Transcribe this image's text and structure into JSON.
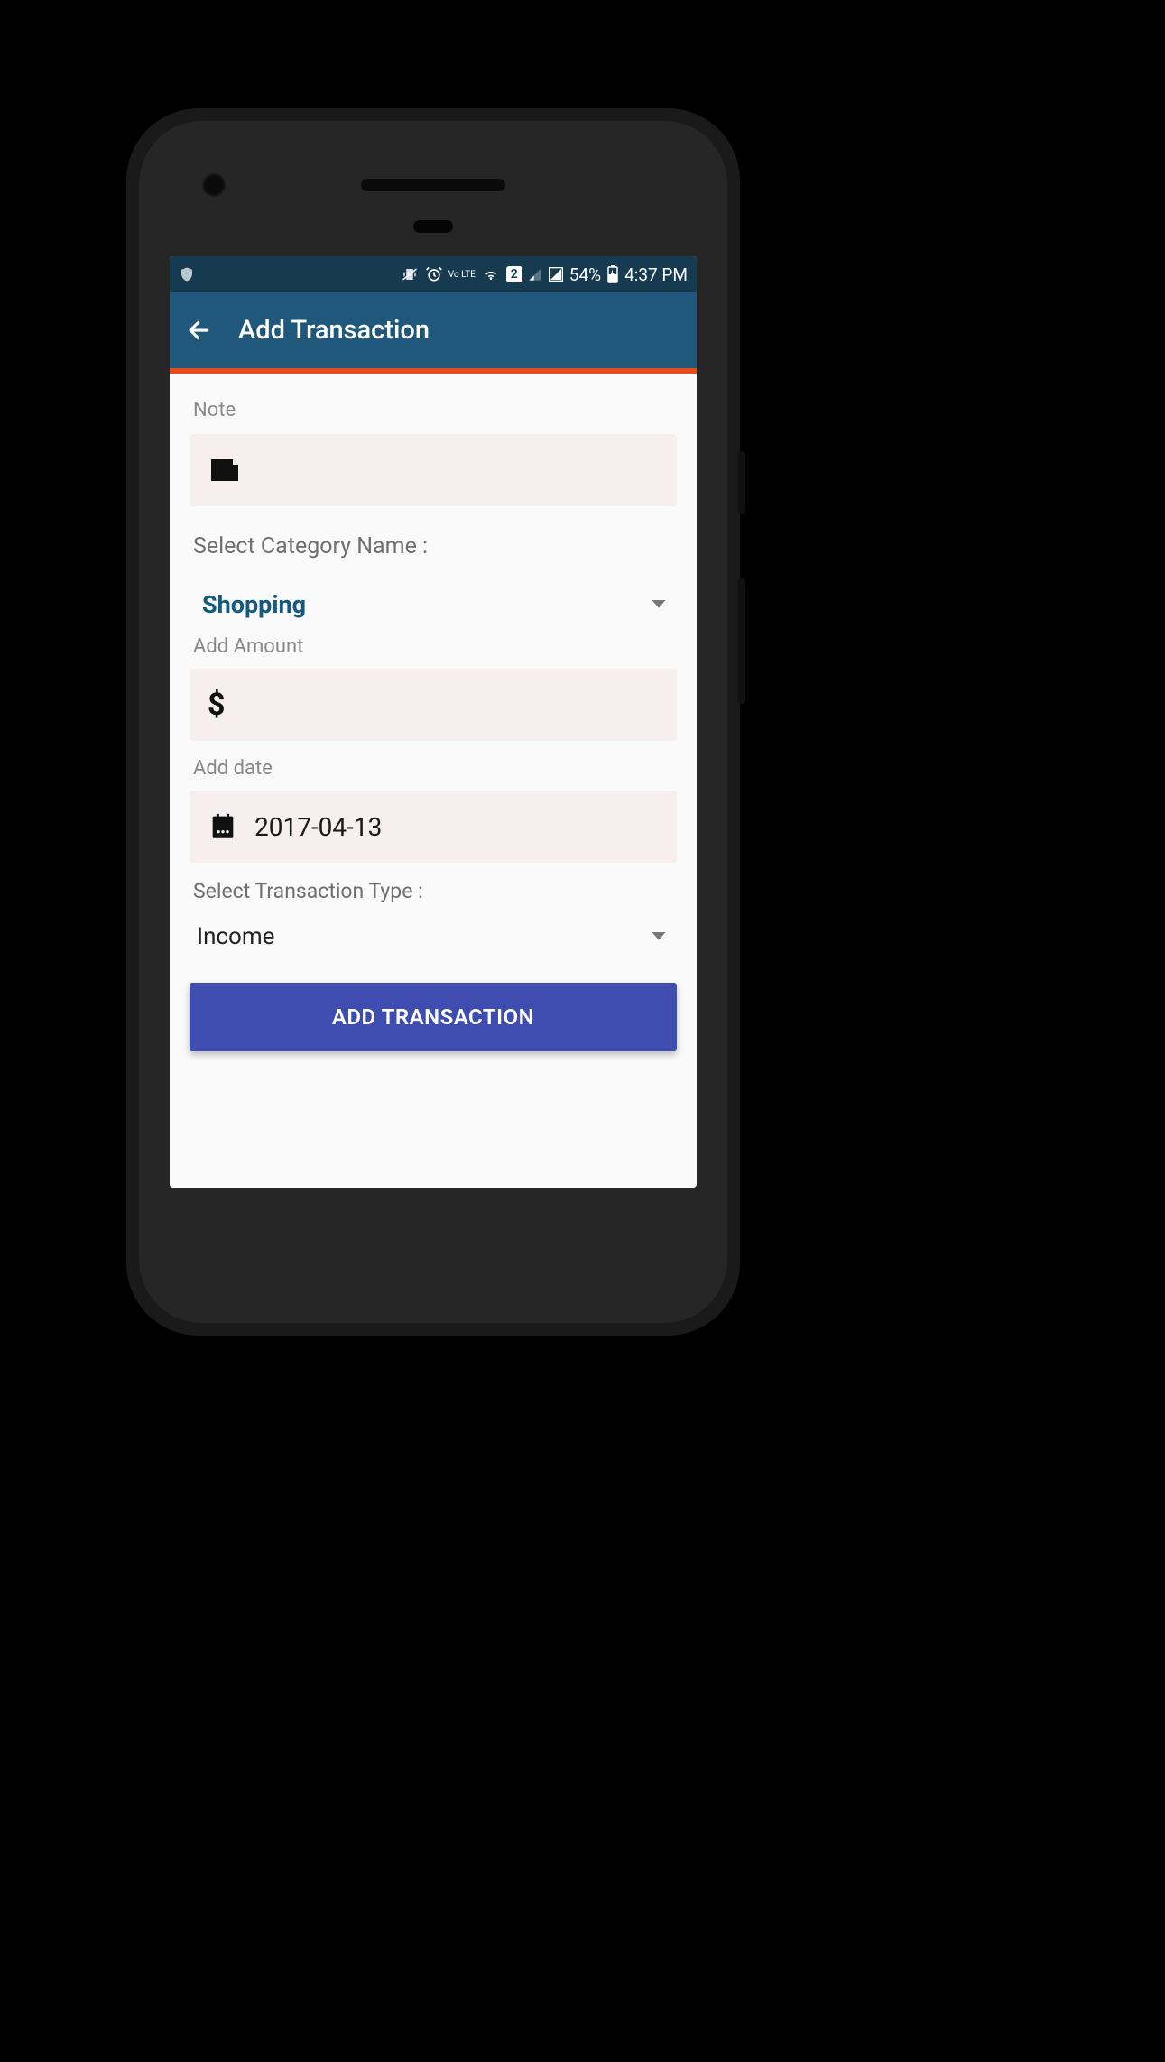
{
  "statusbar": {
    "battery_text": "54%",
    "time": "4:37 PM",
    "lte_label": "Vo LTE",
    "sim_badge": "2"
  },
  "appbar": {
    "title": "Add Transaction"
  },
  "form": {
    "note_label": "Note",
    "note_value": "",
    "category_label": "Select Category Name :",
    "category_value": "Shopping",
    "amount_label": "Add Amount",
    "amount_currency": "$",
    "amount_value": "",
    "date_label": "Add date",
    "date_value": "2017-04-13",
    "type_label": "Select Transaction Type :",
    "type_value": "Income",
    "submit_label": "ADD TRANSACTION"
  }
}
